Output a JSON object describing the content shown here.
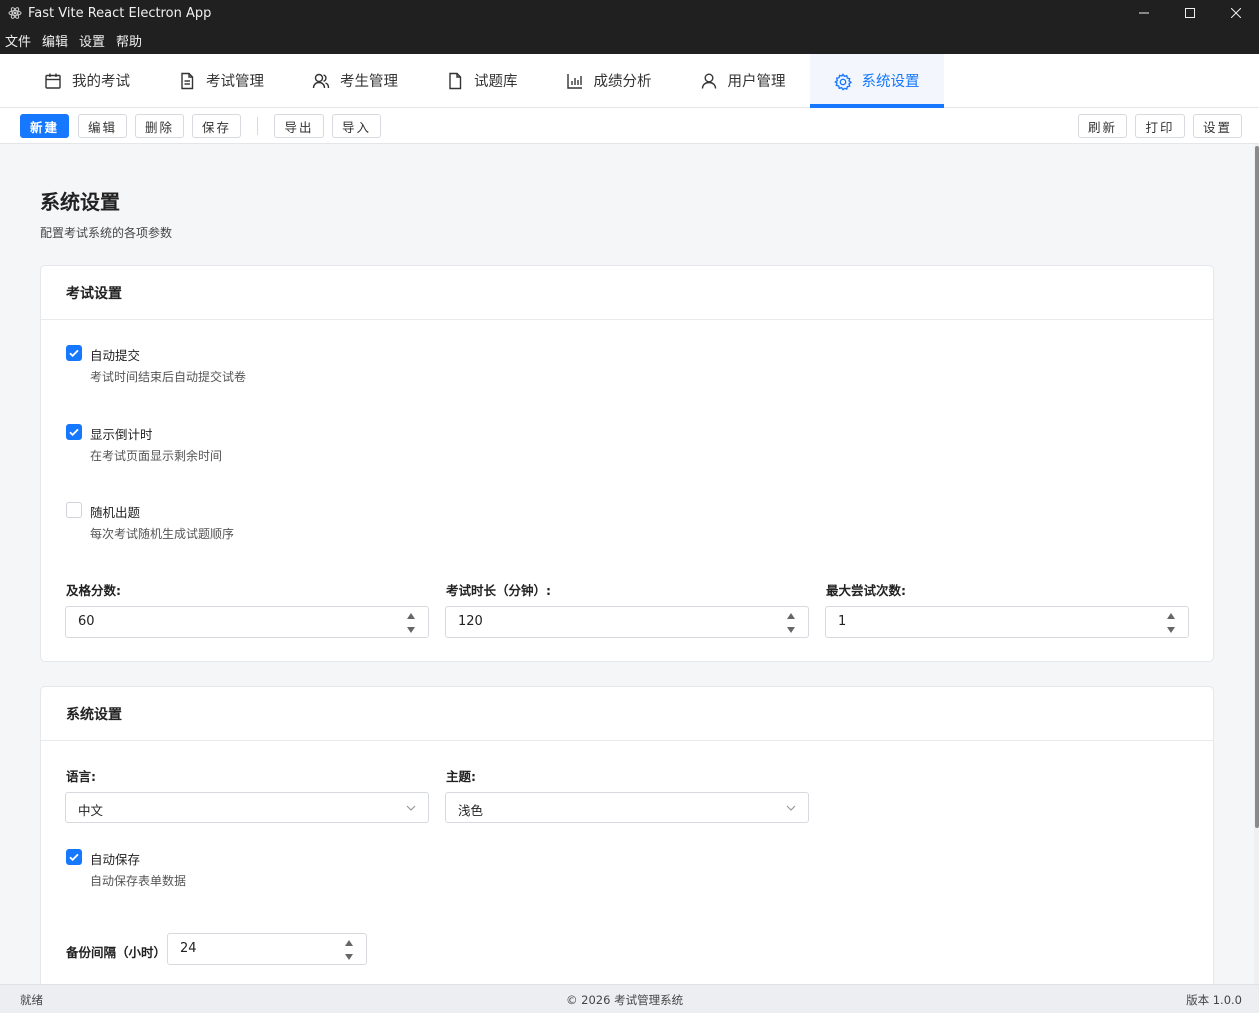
{
  "window": {
    "title": "Fast Vite React Electron App"
  },
  "menu": [
    "文件",
    "编辑",
    "设置",
    "帮助"
  ],
  "tabs": [
    {
      "label": "我的考试",
      "icon": "calendar-icon"
    },
    {
      "label": "考试管理",
      "icon": "document-icon"
    },
    {
      "label": "考生管理",
      "icon": "users-icon"
    },
    {
      "label": "试题库",
      "icon": "file-icon"
    },
    {
      "label": "成绩分析",
      "icon": "bar-chart-icon"
    },
    {
      "label": "用户管理",
      "icon": "user-icon"
    },
    {
      "label": "系统设置",
      "icon": "gear-icon",
      "active": true
    }
  ],
  "toolbar": {
    "new": "新建",
    "edit": "编辑",
    "delete": "删除",
    "save": "保存",
    "export": "导出",
    "import": "导入",
    "refresh": "刷新",
    "print": "打印",
    "settings": "设置"
  },
  "page": {
    "title": "系统设置",
    "subtitle": "配置考试系统的各项参数"
  },
  "exam_settings": {
    "title": "考试设置",
    "options": [
      {
        "label": "自动提交",
        "desc": "考试时间结束后自动提交试卷",
        "checked": true
      },
      {
        "label": "显示倒计时",
        "desc": "在考试页面显示剩余时间",
        "checked": true
      },
      {
        "label": "随机出题",
        "desc": "每次考试随机生成试题顺序",
        "checked": false
      }
    ],
    "pass_score": {
      "label": "及格分数:",
      "value": "60"
    },
    "duration": {
      "label": "考试时长（分钟）:",
      "value": "120"
    },
    "max_attempts": {
      "label": "最大尝试次数:",
      "value": "1"
    }
  },
  "system_settings": {
    "title": "系统设置",
    "language": {
      "label": "语言:",
      "value": "中文"
    },
    "theme": {
      "label": "主题:",
      "value": "浅色"
    },
    "autosave": {
      "label": "自动保存",
      "desc": "自动保存表单数据",
      "checked": true
    },
    "backup": {
      "label": "备份间隔（小时）:",
      "value": "24"
    }
  },
  "status": {
    "left": "就绪",
    "center": "© 2026 考试管理系统",
    "right": "版本 1.0.0"
  },
  "colors": {
    "accent": "#1677ff",
    "titlebar": "#202020"
  }
}
